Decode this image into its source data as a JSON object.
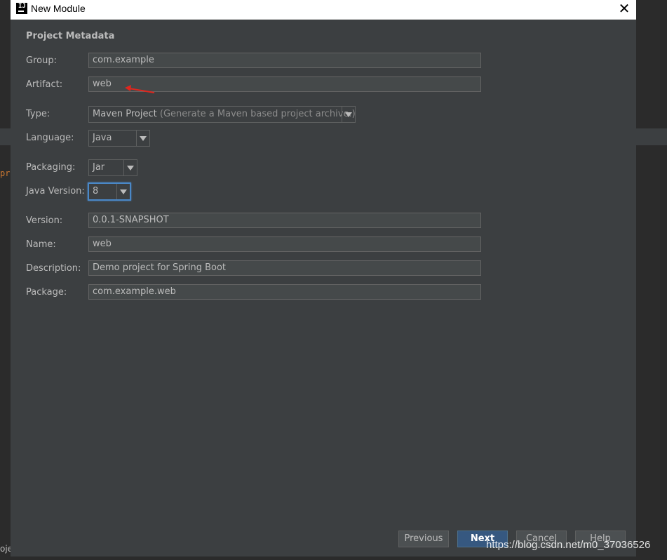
{
  "window": {
    "title": "New Module",
    "close_glyph": "✕"
  },
  "background": {
    "code_fragment": "pr",
    "bottom_text": "oje"
  },
  "section_title": "Project Metadata",
  "fields": {
    "group": {
      "label": "Group:",
      "value": "com.example"
    },
    "artifact": {
      "label": "Artifact:",
      "value": "web"
    },
    "type": {
      "label": "Type:",
      "value": "Maven Project",
      "hint": "(Generate a Maven based project archive.)"
    },
    "language": {
      "label": "Language:",
      "value": "Java"
    },
    "packaging": {
      "label": "Packaging:",
      "value": "Jar"
    },
    "java_version": {
      "label": "Java Version:",
      "value": "8"
    },
    "version": {
      "label": "Version:",
      "value": "0.0.1-SNAPSHOT"
    },
    "name": {
      "label": "Name:",
      "value": "web"
    },
    "description": {
      "label": "Description:",
      "value": "Demo project for Spring Boot"
    },
    "package": {
      "label": "Package:",
      "value": "com.example.web"
    }
  },
  "buttons": {
    "previous": "Previous",
    "next": "Next",
    "cancel": "Cancel",
    "help": "Help"
  },
  "watermark": "https://blog.csdn.net/m0_37036526",
  "colors": {
    "dialog_bg": "#3c3f41",
    "field_bg": "#45494a",
    "primary_button": "#365880",
    "focus": "#4a88c7",
    "annotation_arrow": "#e0261e"
  }
}
